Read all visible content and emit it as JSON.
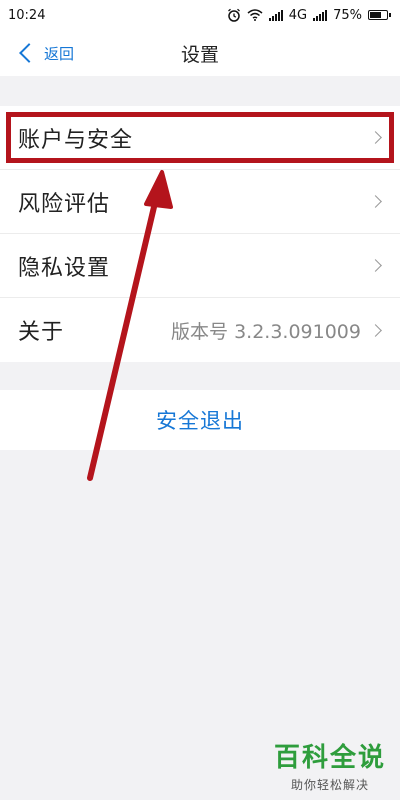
{
  "status_bar": {
    "time": "10:24",
    "network": "4G",
    "battery": "75%",
    "battery_level": 0.75,
    "icons": [
      "alarm-icon",
      "wifi-icon",
      "signal-icon",
      "signal-icon",
      "battery-icon"
    ]
  },
  "header": {
    "back_label": "返回",
    "title": "设置"
  },
  "settings": {
    "items": [
      {
        "label": "账户与安全",
        "value": ""
      },
      {
        "label": "风险评估",
        "value": ""
      },
      {
        "label": "隐私设置",
        "value": ""
      },
      {
        "label": "关于",
        "value": "版本号 3.2.3.091009"
      }
    ]
  },
  "logout": {
    "label": "安全退出"
  },
  "colors": {
    "accent": "#1677d6",
    "highlight": "#b4141c",
    "background": "#f2f2f4"
  },
  "watermark": {
    "main": "百科全说",
    "sub": "助你轻松解决"
  }
}
